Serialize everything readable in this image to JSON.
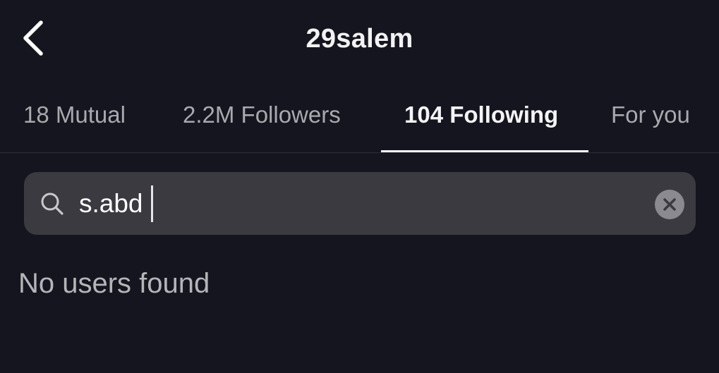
{
  "header": {
    "title": "29salem",
    "back_icon": "chevron-left-icon"
  },
  "tabs": [
    {
      "label": "18 Mutual",
      "active": false
    },
    {
      "label": "2.2M Followers",
      "active": false
    },
    {
      "label": "104 Following",
      "active": true
    },
    {
      "label": "For you",
      "active": false
    }
  ],
  "search": {
    "value": "s.abd",
    "search_icon": "search-icon",
    "clear_icon": "close-icon"
  },
  "results": {
    "empty_message": "No users found"
  },
  "colors": {
    "background": "#14151f",
    "search_field": "#3a3a40",
    "active_text": "#f4f4f4",
    "inactive_text": "#a9a9ad"
  }
}
